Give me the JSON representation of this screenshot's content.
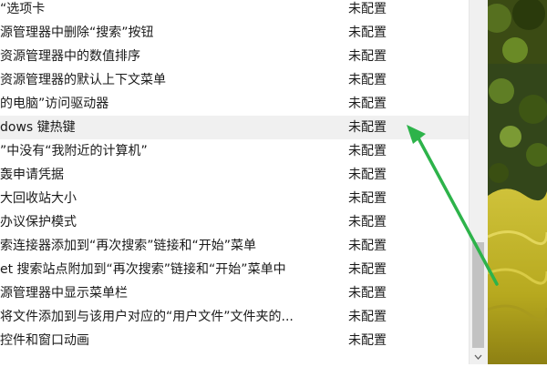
{
  "policy_list": {
    "items": [
      {
        "name": "“选项卡",
        "state": "未配置"
      },
      {
        "name": "源管理器中删除“搜索”按钮",
        "state": "未配置"
      },
      {
        "name": "资源管理器中的数值排序",
        "state": "未配置"
      },
      {
        "name": "资源管理器的默认上下文菜单",
        "state": "未配置"
      },
      {
        "name": "的电脑”访问驱动器",
        "state": "未配置"
      },
      {
        "name": "dows 键热键",
        "state": "未配置",
        "selected": true
      },
      {
        "name": "”中没有“我附近的计算机”",
        "state": "未配置"
      },
      {
        "name": "轰申请凭据",
        "state": "未配置"
      },
      {
        "name": "大回收站大小",
        "state": "未配置"
      },
      {
        "name": "办议保护模式",
        "state": "未配置"
      },
      {
        "name": "索连接器添加到“再次搜索”链接和“开始”菜单",
        "state": "未配置"
      },
      {
        "name": "et 搜索站点附加到“再次搜索”链接和“开始”菜单中",
        "state": "未配置"
      },
      {
        "name": "源管理器中显示菜单栏",
        "state": "未配置"
      },
      {
        "name": "将文件添加到与该用户对应的“用户文件”文件夹的...",
        "state": "未配置"
      },
      {
        "name": "控件和窗口动画",
        "state": "未配置"
      }
    ]
  },
  "colors": {
    "annotation_arrow": "#2db34a",
    "selected_row": "#f0f0f0",
    "scrollbar_thumb": "#c2c2c2"
  }
}
